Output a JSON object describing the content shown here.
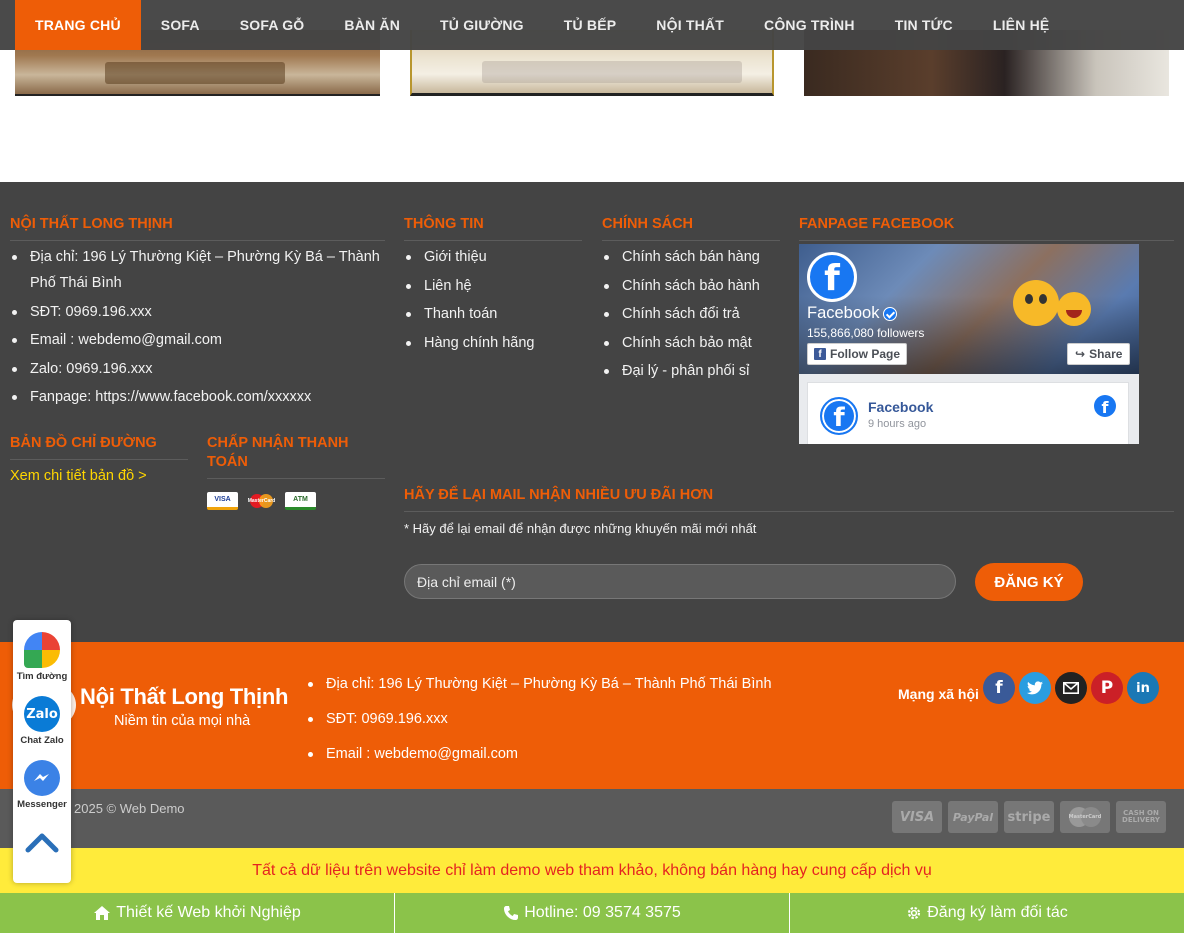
{
  "nav": {
    "items": [
      {
        "label": "TRANG CHỦ"
      },
      {
        "label": "SOFA"
      },
      {
        "label": "SOFA GỖ"
      },
      {
        "label": "BÀN ĂN"
      },
      {
        "label": "TỦ GIƯỜNG"
      },
      {
        "label": "TỦ BẾP"
      },
      {
        "label": "NỘI THẤT"
      },
      {
        "label": "CÔNG TRÌNH"
      },
      {
        "label": "TIN TỨC"
      },
      {
        "label": "LIÊN HỆ"
      }
    ]
  },
  "footer": {
    "company": {
      "title": "NỘI THẤT LONG THỊNH",
      "items": [
        "Địa chỉ: 196 Lý Thường Kiệt – Phường Kỳ Bá – Thành Phố Thái Bình",
        "SĐT: 0969.196.xxx",
        "Email : webdemo@gmail.com",
        "Zalo: 0969.196.xxx",
        "Fanpage: https://www.facebook.com/xxxxxx"
      ]
    },
    "info": {
      "title": "THÔNG TIN",
      "items": [
        "Giới thiệu",
        "Liên hệ",
        "Thanh toán",
        "Hàng chính hãng"
      ]
    },
    "policy": {
      "title": "CHÍNH SÁCH",
      "items": [
        "Chính sách bán hàng",
        "Chính sách bảo hành",
        "Chính sách đổi trả",
        "Chính sách bảo mật",
        "Đại lý - phân phối sỉ"
      ]
    },
    "fanpage": {
      "title": "FANPAGE FACEBOOK",
      "page_name": "Facebook",
      "followers": "155,866,080 followers",
      "follow_label": "Follow Page",
      "share_label": "Share",
      "post_name": "Facebook",
      "post_time": "9 hours ago"
    },
    "map": {
      "title": "BẢN ĐỒ CHỈ ĐƯỜNG",
      "link": "Xem chi tiết bản đồ >"
    },
    "payment": {
      "title": "CHẤP NHẬN THANH TOÁN",
      "cards": [
        "VISA",
        "MasterCard",
        "ATM"
      ]
    },
    "newsletter": {
      "title": "HÃY ĐỂ LẠI MAIL NHẬN NHIỀU ƯU ĐÃI HƠN",
      "note": "* Hãy để lại email để nhận được những khuyến mãi mới nhất",
      "placeholder": "Địa chỉ email (*)",
      "button": "ĐĂNG KÝ"
    }
  },
  "band": {
    "brand_name": "Nội Thất Long Thịnh",
    "slogan": "Niềm tin của mọi nhà",
    "items": [
      "Địa chỉ: 196 Lý Thường Kiệt – Phường Kỳ Bá – Thành Phố Thái Bình",
      "SĐT: 0969.196.xxx",
      "Email : webdemo@gmail.com"
    ],
    "social_label": "Mạng xã hội",
    "socials": [
      "facebook-icon",
      "twitter-icon",
      "email-icon",
      "pinterest-icon",
      "linkedin-icon"
    ]
  },
  "copyright": {
    "text": "2025 © Web Demo",
    "logos": [
      "VISA",
      "PayPal",
      "stripe",
      "MasterCard",
      "CASH ON DELIVERY"
    ]
  },
  "notice": "Tất cả dữ liệu trên website chỉ làm demo web tham khảo, không bán hàng hay cung cấp dịch vụ",
  "bottom_bar": [
    {
      "icon": "home-icon",
      "label": "Thiết kế Web khởi Nghiệp"
    },
    {
      "icon": "phone-icon",
      "label": "Hotline: 09 3574 3575"
    },
    {
      "icon": "gear-icon",
      "label": "Đăng ký làm đối tác"
    }
  ],
  "floating": {
    "maps_label": "Tìm đường",
    "zalo_label": "Chat Zalo",
    "zalo_icon_text": "Zalo",
    "messenger_label": "Messenger"
  },
  "colors": {
    "accent": "#ee5d07",
    "footer_bg": "#444444",
    "notice_bg": "#ffeb3b",
    "notice_text": "#e52420",
    "bottom_bar": "#8bc34a"
  }
}
